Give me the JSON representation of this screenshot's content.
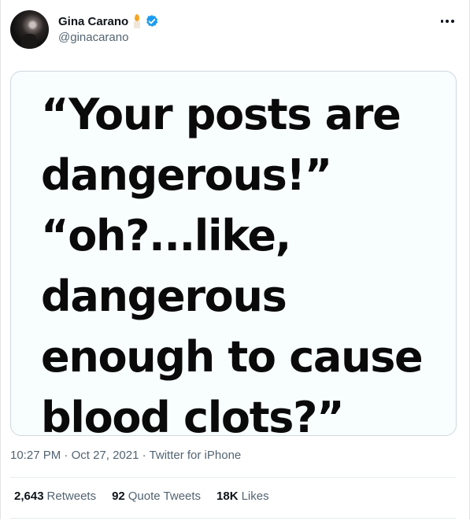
{
  "author": {
    "name": "Gina Carano",
    "handle": "@ginacarano",
    "avatar": "profile-photo",
    "badges": [
      "candle-emoji",
      "verified-badge"
    ],
    "verified_color": "#1d9bf0"
  },
  "tweet": {
    "image_text_lines": [
      "“Your posts are",
      "dangerous!”",
      "“oh?...like,",
      "dangerous",
      "enough to cause",
      "blood clots?”"
    ],
    "time": "10:27 PM",
    "separator": "·",
    "date": "Oct 27, 2021",
    "source": "Twitter for iPhone"
  },
  "stats": {
    "retweets_count": "2,643",
    "retweets_label": "Retweets",
    "quotes_count": "92",
    "quotes_label": "Quote Tweets",
    "likes_count": "18K",
    "likes_label": "Likes"
  },
  "icons": {
    "more": "more-dots-icon"
  }
}
